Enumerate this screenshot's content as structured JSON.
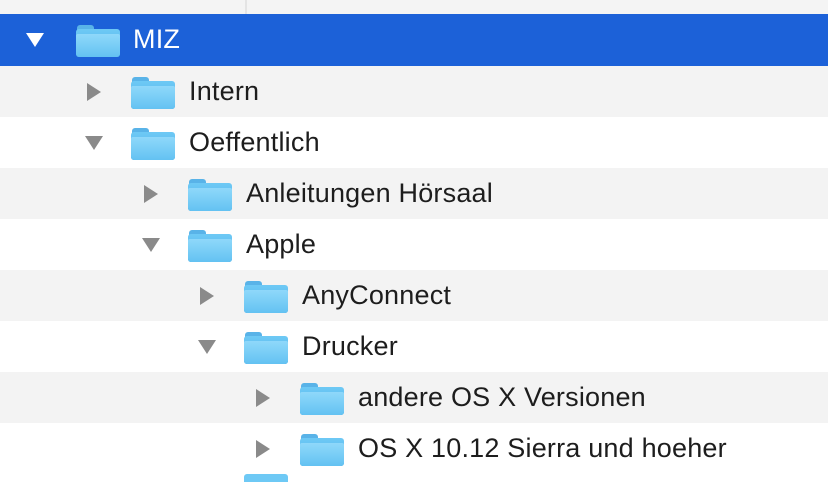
{
  "folder_tree": {
    "rows": [
      {
        "label": "MIZ",
        "expanded": true,
        "selected": true,
        "level": 0
      },
      {
        "label": "Intern",
        "expanded": false,
        "selected": false,
        "level": 1
      },
      {
        "label": "Oeffentlich",
        "expanded": true,
        "selected": false,
        "level": 1
      },
      {
        "label": "Anleitungen Hörsaal",
        "expanded": false,
        "selected": false,
        "level": 2
      },
      {
        "label": "Apple",
        "expanded": true,
        "selected": false,
        "level": 2
      },
      {
        "label": "AnyConnect",
        "expanded": false,
        "selected": false,
        "level": 3
      },
      {
        "label": "Drucker",
        "expanded": true,
        "selected": false,
        "level": 3
      },
      {
        "label": "andere OS X Versionen",
        "expanded": false,
        "selected": false,
        "level": 4
      },
      {
        "label": "OS X 10.12 Sierra und hoeher",
        "expanded": false,
        "selected": false,
        "level": 4
      }
    ]
  },
  "colors": {
    "selection": "#1c61d8",
    "folder": "#63c2f2",
    "row_alt": "#f3f3f3",
    "disclosure": "#8a8a8a"
  },
  "icons": {
    "folder": "folder-icon",
    "collapsed": "disclosure-triangle-right-icon",
    "expanded": "disclosure-triangle-down-icon"
  }
}
